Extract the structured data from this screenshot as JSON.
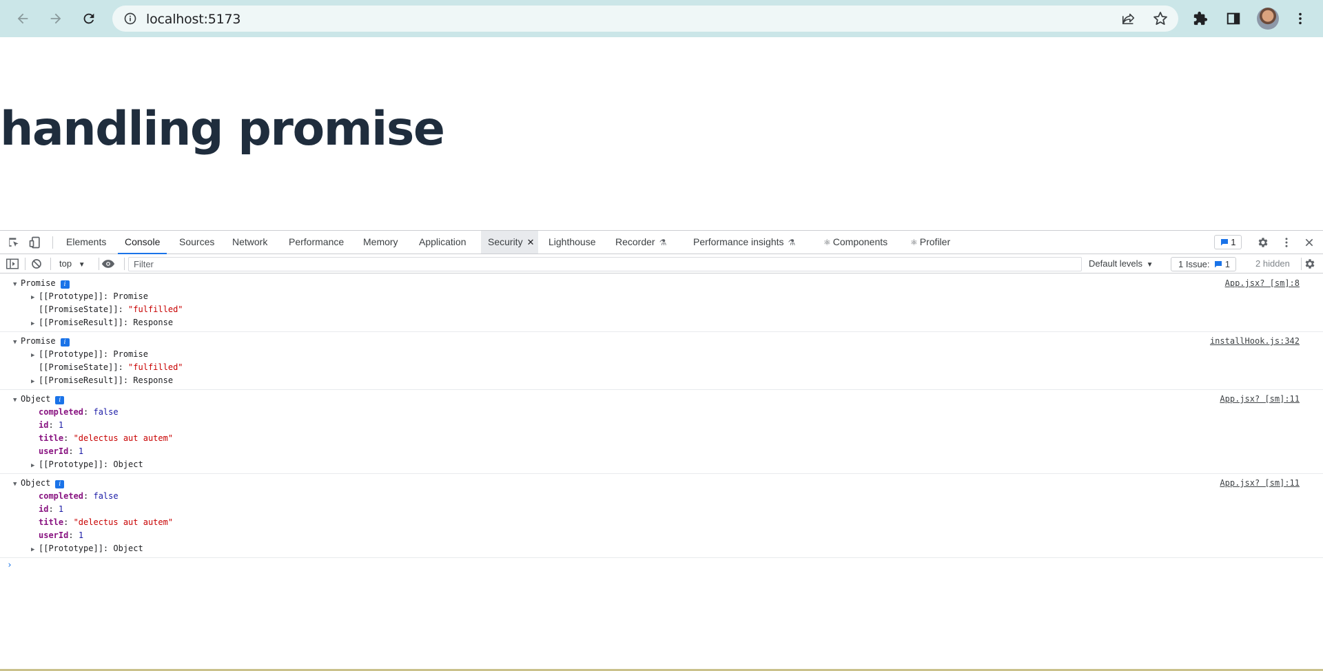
{
  "browser": {
    "url": "localhost:5173"
  },
  "page": {
    "heading": "handling promise"
  },
  "devtools": {
    "tabs": [
      {
        "label": "Elements"
      },
      {
        "label": "Console"
      },
      {
        "label": "Sources"
      },
      {
        "label": "Network"
      },
      {
        "label": "Performance"
      },
      {
        "label": "Memory"
      },
      {
        "label": "Application"
      },
      {
        "label": "Security"
      },
      {
        "label": "Lighthouse"
      },
      {
        "label": "Recorder"
      },
      {
        "label": "Performance insights"
      },
      {
        "label": "Components"
      },
      {
        "label": "Profiler"
      }
    ],
    "issues_badge_count": "1",
    "toolbar": {
      "context": "top",
      "filter_placeholder": "Filter",
      "levels": "Default levels",
      "issues_label": "1 Issue:",
      "issues_count": "1",
      "hidden": "2 hidden"
    },
    "console": {
      "messages": [
        {
          "type": "Promise",
          "source": "App.jsx? [sm]:8",
          "rows": [
            {
              "key": "[[Prototype]]",
              "value": "Promise"
            },
            {
              "key": "[[PromiseState]]",
              "value": "\"fulfilled\""
            },
            {
              "key": "[[PromiseResult]]",
              "value": "Response"
            }
          ]
        },
        {
          "type": "Promise",
          "source": "installHook.js:342",
          "rows": [
            {
              "key": "[[Prototype]]",
              "value": "Promise"
            },
            {
              "key": "[[PromiseState]]",
              "value": "\"fulfilled\""
            },
            {
              "key": "[[PromiseResult]]",
              "value": "Response"
            }
          ]
        },
        {
          "type": "Object",
          "source": "App.jsx? [sm]:11",
          "rows": [
            {
              "key": "completed",
              "value": "false"
            },
            {
              "key": "id",
              "value": "1"
            },
            {
              "key": "title",
              "value": "\"delectus aut autem\""
            },
            {
              "key": "userId",
              "value": "1"
            },
            {
              "key": "[[Prototype]]",
              "value": "Object"
            }
          ]
        },
        {
          "type": "Object",
          "source": "App.jsx? [sm]:11",
          "rows": [
            {
              "key": "completed",
              "value": "false"
            },
            {
              "key": "id",
              "value": "1"
            },
            {
              "key": "title",
              "value": "\"delectus aut autem\""
            },
            {
              "key": "userId",
              "value": "1"
            },
            {
              "key": "[[Prototype]]",
              "value": "Object"
            }
          ]
        }
      ]
    }
  }
}
